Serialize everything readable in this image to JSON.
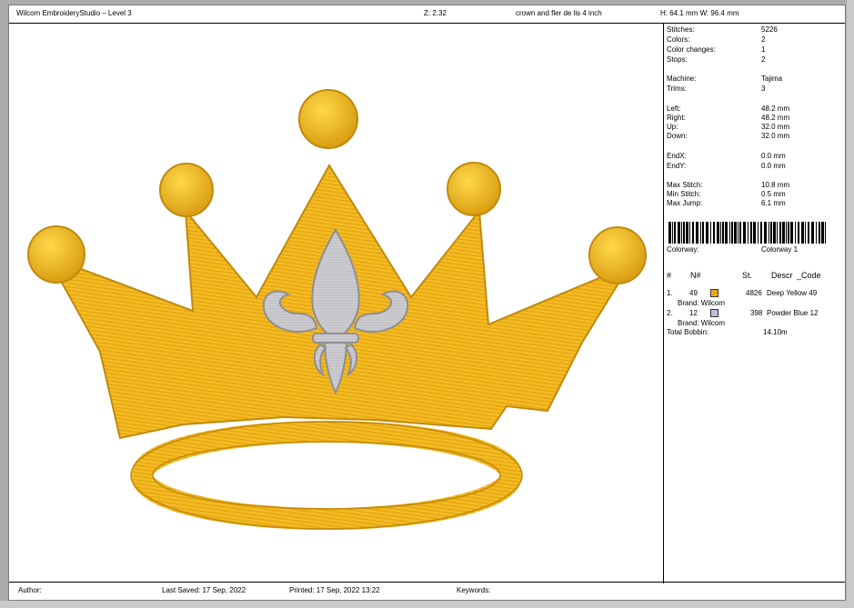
{
  "header": {
    "app_title": "Wilcom EmbroideryStudio – Level 3",
    "zoom": "Z: 2.32",
    "design_name": "crown and fler de lis 4 inch",
    "dimensions": "H: 64.1 mm  W: 96.4 mm"
  },
  "stats": [
    {
      "label": "Stitches:",
      "value": "5226"
    },
    {
      "label": "Colors:",
      "value": "2"
    },
    {
      "label": "Color changes:",
      "value": "1"
    },
    {
      "label": "Stops:",
      "value": "2"
    },
    {
      "label": "Machine:",
      "value": "Tajima"
    },
    {
      "label": "Trims:",
      "value": "3"
    },
    {
      "label": "Left:",
      "value": "48.2 mm"
    },
    {
      "label": "Right:",
      "value": "48.2 mm"
    },
    {
      "label": "Up:",
      "value": "32.0 mm"
    },
    {
      "label": "Down:",
      "value": "32.0 mm"
    },
    {
      "label": "EndX:",
      "value": "0.0 mm"
    },
    {
      "label": "EndY:",
      "value": "0.0 mm"
    },
    {
      "label": "Max Stitch:",
      "value": "10.8 mm"
    },
    {
      "label": "Min Stitch:",
      "value": "0.5 mm"
    },
    {
      "label": "Max Jump:",
      "value": "6.1 mm"
    }
  ],
  "colorway": {
    "label": "Colorway:",
    "value": "Colorway 1"
  },
  "thread_table": {
    "headers": {
      "index": "#",
      "number": "N#",
      "stitches": "St.",
      "descr": "Descr",
      "code": "_Code"
    },
    "rows": [
      {
        "index": "1.",
        "number": "49",
        "color": "#f0a81a",
        "stitches": "4826",
        "descr": "Deep Yellow 49",
        "brand": "Brand: Wilcom"
      },
      {
        "index": "2.",
        "number": "12",
        "color": "#b9bfdc",
        "stitches": "398",
        "descr": "Powder Blue 12",
        "brand": "Brand: Wilcom"
      }
    ],
    "total_bobbin_label": "Total Bobbin:",
    "total_bobbin_value": "14.10m"
  },
  "footer": {
    "author": "Author:",
    "last_saved": "Last Saved: 17 Sep, 2022",
    "printed": "Printed: 17 Sep, 2022 13:22",
    "keywords": "Keywords:"
  },
  "design_colors": {
    "gold": "#f2b51a",
    "gold_dark": "#c08a0c",
    "silver": "#c8c8cc",
    "silver_dark": "#8e8e94"
  }
}
